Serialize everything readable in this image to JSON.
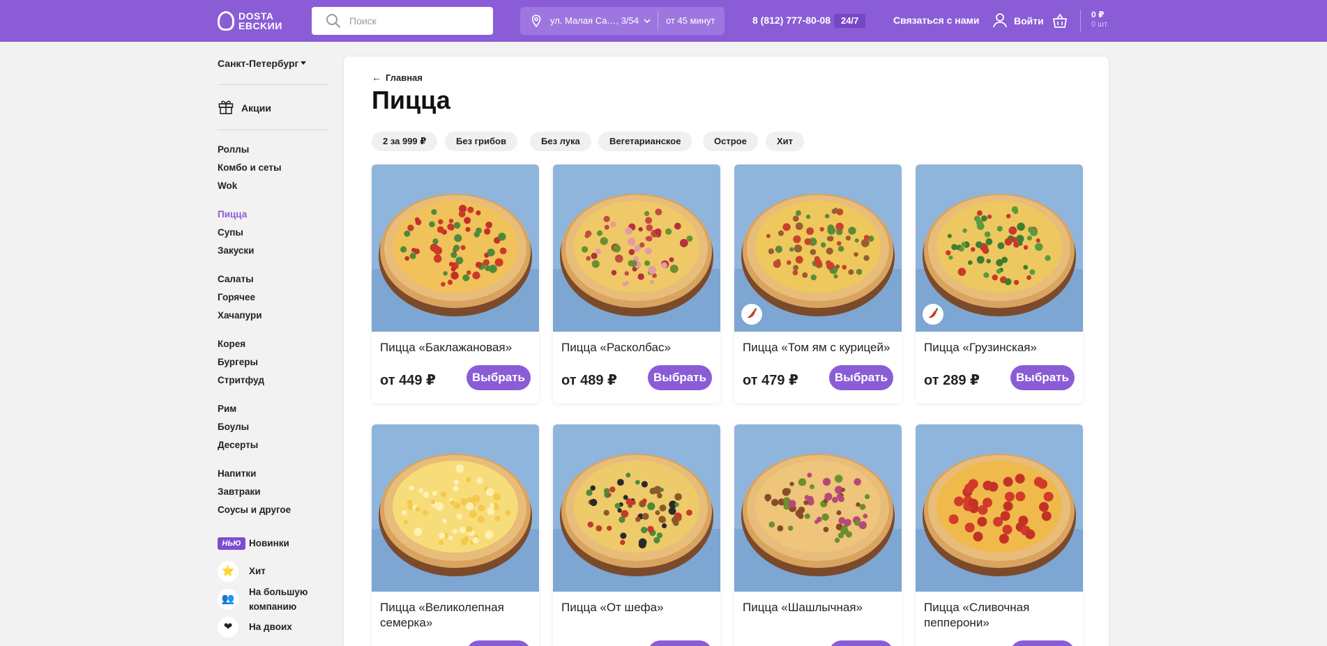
{
  "header": {
    "logo_line1": "DOSTA",
    "logo_line2": "EBCKИИ",
    "search_placeholder": "Поиск",
    "address": "ул. Малая Са…, 3/54",
    "delivery_time": "от 45 минут",
    "phone": "8 (812) 777-80-08",
    "hours_badge": "24/7",
    "contact_label": "Связаться с нами",
    "login_label": "Войти",
    "cart_sum": "0 ₽",
    "cart_count": "0 шт.",
    "brand_color": "#8a5dd6"
  },
  "sidebar": {
    "city": "Санкт-Петербург",
    "promo_label": "Акции",
    "groups": [
      [
        "Роллы",
        "Комбо и сеты",
        "Wok"
      ],
      [
        "Пицца",
        "Супы",
        "Закуски"
      ],
      [
        "Салаты",
        "Горячее",
        "Хачапури"
      ],
      [
        "Корея",
        "Бургеры",
        "Стритфуд"
      ],
      [
        "Рим",
        "Боулы",
        "Десерты"
      ],
      [
        "Напитки",
        "Завтраки",
        "Соусы и другое"
      ]
    ],
    "active_item": "Пицца",
    "new_badge": "НЬЮ",
    "new_label": "Новинки",
    "hit_label": "Хит",
    "company_label_line1": "На большую",
    "company_label_line2": "компанию",
    "couple_label": "На двоих"
  },
  "main": {
    "breadcrumb": "Главная",
    "title": "Пицца",
    "filters": [
      "2 за 999 ₽",
      "Без грибов",
      "Без лука",
      "Вегетарианское",
      "Острое",
      "Хит"
    ],
    "choose_label": "Выбрать",
    "products": [
      {
        "name": "Пицца «Баклажановая»",
        "price": "от 449 ₽",
        "spicy": false,
        "topping": "veggie"
      },
      {
        "name": "Пицца «Расколбас»",
        "price": "от 489 ₽",
        "spicy": false,
        "topping": "meat"
      },
      {
        "name": "Пицца «Том ям с курицей»",
        "price": "от 479 ₽",
        "spicy": true,
        "topping": "chicken"
      },
      {
        "name": "Пицца «Грузинская»",
        "price": "от 289 ₽",
        "spicy": true,
        "topping": "herbs"
      },
      {
        "name": "Пицца «Великолепная семерка»",
        "price": "",
        "spicy": false,
        "topping": "cheese"
      },
      {
        "name": "Пицца «От шефа»",
        "price": "",
        "spicy": false,
        "topping": "olives"
      },
      {
        "name": "Пицца «Шашлычная»",
        "price": "",
        "spicy": false,
        "topping": "bbq"
      },
      {
        "name": "Пицца «Сливочная пепперони»",
        "price": "",
        "spicy": false,
        "topping": "pepperoni"
      }
    ]
  }
}
